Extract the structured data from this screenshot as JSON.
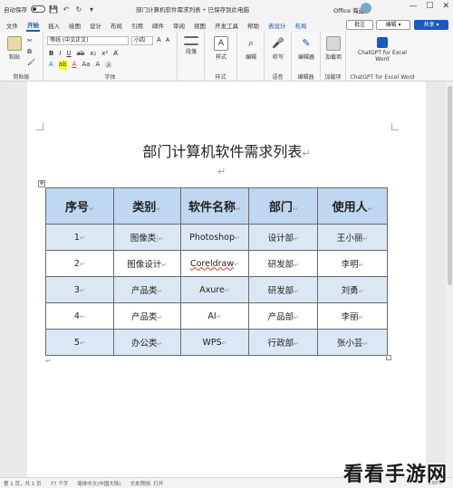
{
  "titlebar": {
    "autosave_label": "自动保存",
    "autosave_state": "关",
    "doc_title": "部门计算机软件需求列表 • 已保存到此电脑",
    "user_name": "Office 海盗",
    "minimize": "—",
    "maximize": "☐",
    "close": "✕"
  },
  "tabs": [
    {
      "label": "文件"
    },
    {
      "label": "开始"
    },
    {
      "label": "插入"
    },
    {
      "label": "绘图"
    },
    {
      "label": "设计"
    },
    {
      "label": "布局"
    },
    {
      "label": "引用"
    },
    {
      "label": "邮件"
    },
    {
      "label": "审阅"
    },
    {
      "label": "视图"
    },
    {
      "label": "开发工具"
    },
    {
      "label": "帮助"
    },
    {
      "label": "表设计"
    },
    {
      "label": "布局"
    }
  ],
  "actions": {
    "comment": "批注",
    "edit": "编辑 ▾",
    "share": "共享 ▾"
  },
  "ribbon": {
    "paste": "粘贴",
    "clipboard": "剪贴板",
    "font_name": "等线 (中文正文)",
    "font_size": "小四",
    "font_group": "字体",
    "paragraph": "段落",
    "styles": "样式",
    "styles_group": "样式",
    "editing": "编辑",
    "dictate": "听写",
    "voice_group": "语音",
    "editor": "编辑器",
    "editor_group": "编辑器",
    "addins": "加载项",
    "addins_group": "加载项",
    "chatgpt": "ChatGPT for Excel Word",
    "chatgpt_group": "ChatGPT for Excel Word"
  },
  "document": {
    "heading": "部门计算机软件需求列表",
    "table": {
      "headers": [
        "序号",
        "类别",
        "软件名称",
        "部门",
        "使用人"
      ],
      "rows": [
        [
          "1",
          "图像类",
          "Photoshop",
          "设计部",
          "王小丽"
        ],
        [
          "2",
          "图像设计",
          "Coreldraw",
          "研发部",
          "李明"
        ],
        [
          "3",
          "产品类",
          "Axure",
          "研发部",
          "刘勇"
        ],
        [
          "4",
          "产品类",
          "AI",
          "产品部",
          "李丽"
        ],
        [
          "5",
          "办公类",
          "WPS",
          "行政部",
          "张小芸"
        ]
      ]
    }
  },
  "statusbar": {
    "page": "第 1 页，共 1 页",
    "words": "77 个字",
    "language": "简体中文(中国大陆)",
    "predict": "文本预测: 打开",
    "zoom": "130%"
  },
  "watermark": "看看手游网"
}
